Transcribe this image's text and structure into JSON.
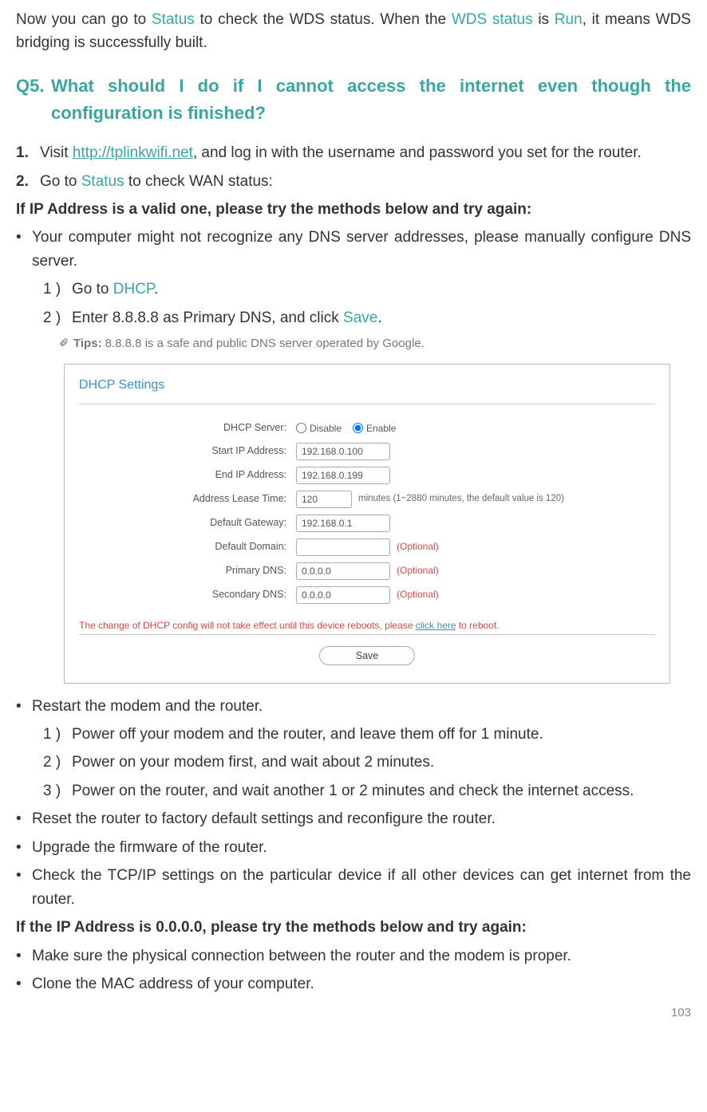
{
  "intro": {
    "pre": "Now you can go to ",
    "status": "Status",
    "mid1": " to check the WDS status. When the ",
    "wds": "WDS status",
    "mid2": " is ",
    "run": "Run",
    "post": ", it means WDS bridging is successfully built."
  },
  "q5": {
    "num": "Q5.",
    "text": "What should I do if I cannot access the internet even though the configuration is finished?"
  },
  "step1": {
    "n": "1.",
    "pre": "Visit ",
    "link": "http://tplinkwifi.net",
    "post": ", and log in with the username and password you set for the router."
  },
  "step2": {
    "n": "2.",
    "pre": "Go to ",
    "status": "Status",
    "post": " to check WAN status:"
  },
  "cond1": "If IP Address is a valid one, please try the methods below and try again:",
  "b1": "Your computer might not recognize any DNS server addresses, please manually configure DNS server.",
  "s1a": {
    "n": "1 )",
    "pre": "Go to ",
    "hl": "DHCP",
    "post": "."
  },
  "s1b": {
    "n": "2 )",
    "pre": "Enter 8.8.8.8 as Primary DNS, and click ",
    "hl": "Save",
    "post": "."
  },
  "tips": {
    "label": "Tips:",
    "text": "8.8.8.8 is a safe and public DNS server operated by Google."
  },
  "dhcp": {
    "title": "DHCP Settings",
    "rows": {
      "server": {
        "label": "DHCP Server:",
        "disable": "Disable",
        "enable": "Enable"
      },
      "start": {
        "label": "Start IP Address:",
        "value": "192.168.0.100"
      },
      "end": {
        "label": "End IP Address:",
        "value": "192.168.0.199"
      },
      "lease": {
        "label": "Address Lease Time:",
        "value": "120",
        "hint": "minutes (1~2880 minutes, the default value is 120)"
      },
      "gw": {
        "label": "Default Gateway:",
        "value": "192.168.0.1"
      },
      "domain": {
        "label": "Default Domain:",
        "value": "",
        "opt": "(Optional)"
      },
      "pdns": {
        "label": "Primary DNS:",
        "value": "0.0.0.0",
        "opt": "(Optional)"
      },
      "sdns": {
        "label": "Secondary DNS:",
        "value": "0.0.0.0",
        "opt": "(Optional)"
      }
    },
    "warn_pre": "The change of DHCP config will not take effect until this device reboots, please ",
    "warn_link": "click here",
    "warn_post": " to reboot.",
    "save": "Save"
  },
  "b2": "Restart the modem and the router.",
  "s2a": {
    "n": "1 )",
    "t": "Power off your modem and the router, and leave them off for 1 minute."
  },
  "s2b": {
    "n": "2 )",
    "t": "Power on your modem first, and wait about 2 minutes."
  },
  "s2c": {
    "n": "3 )",
    "t": "Power on the router, and wait another 1 or 2 minutes and check the internet access."
  },
  "b3": "Reset the router to factory default settings and reconfigure the router.",
  "b4": "Upgrade the firmware of the router.",
  "b5": "Check the TCP/IP settings on the particular device if all other devices can get internet from the router.",
  "cond2": "If the IP Address is 0.0.0.0, please try the methods below and try again:",
  "b6": "Make sure the physical connection between the router and the modem is proper.",
  "b7": "Clone the MAC address of your computer.",
  "page": "103"
}
